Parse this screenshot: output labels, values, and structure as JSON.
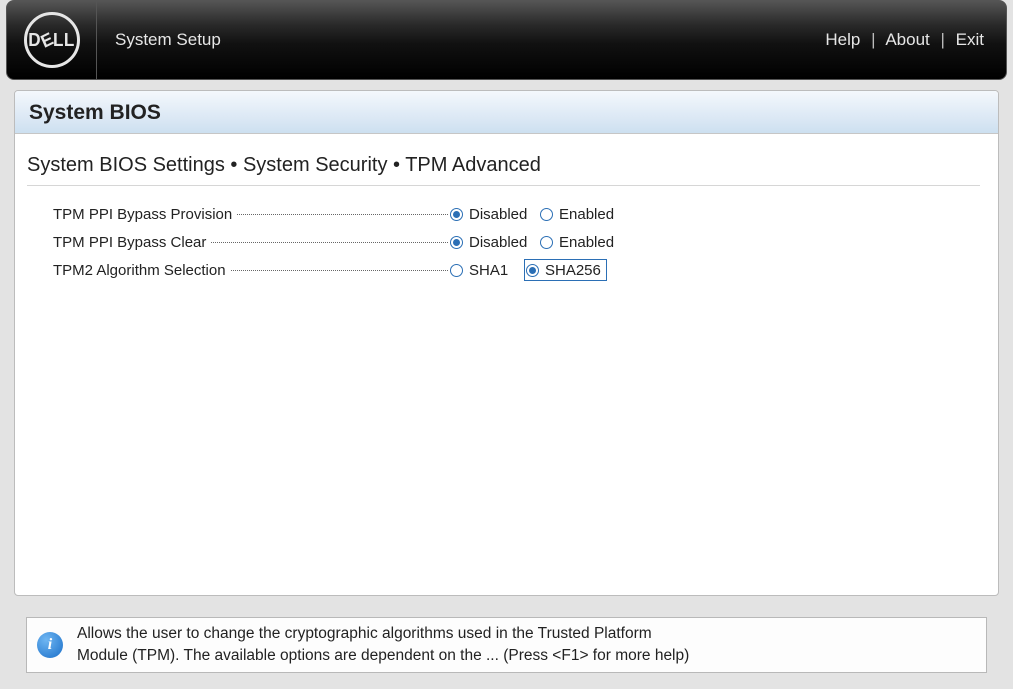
{
  "header": {
    "logo_text_parts": [
      "D",
      "E",
      "L",
      "L"
    ],
    "app_title": "System Setup",
    "links": {
      "help": "Help",
      "about": "About",
      "exit": "Exit"
    },
    "sep": "|"
  },
  "panel": {
    "title": "System BIOS",
    "breadcrumb": "System BIOS Settings • System Security • TPM Advanced"
  },
  "settings": [
    {
      "id": "tpm-ppi-bypass-provision",
      "label": "TPM PPI Bypass Provision",
      "options": [
        {
          "label": "Disabled",
          "selected": true
        },
        {
          "label": "Enabled",
          "selected": false
        }
      ],
      "col_classes": [
        "col0",
        "col1"
      ]
    },
    {
      "id": "tpm-ppi-bypass-clear",
      "label": "TPM PPI Bypass Clear",
      "options": [
        {
          "label": "Disabled",
          "selected": true
        },
        {
          "label": "Enabled",
          "selected": false
        }
      ],
      "col_classes": [
        "col0",
        "col1"
      ]
    },
    {
      "id": "tpm2-algorithm-selection",
      "label": "TPM2 Algorithm Selection",
      "options": [
        {
          "label": "SHA1",
          "selected": false
        },
        {
          "label": "SHA256",
          "selected": true,
          "focused": true
        }
      ],
      "col_classes": [
        "colA",
        ""
      ]
    }
  ],
  "help": {
    "icon_glyph": "i",
    "text_line1": "Allows the user to change the cryptographic algorithms used in the Trusted Platform",
    "text_line2": "Module (TPM). The available options are dependent on the ... (Press <F1> for more help)"
  }
}
